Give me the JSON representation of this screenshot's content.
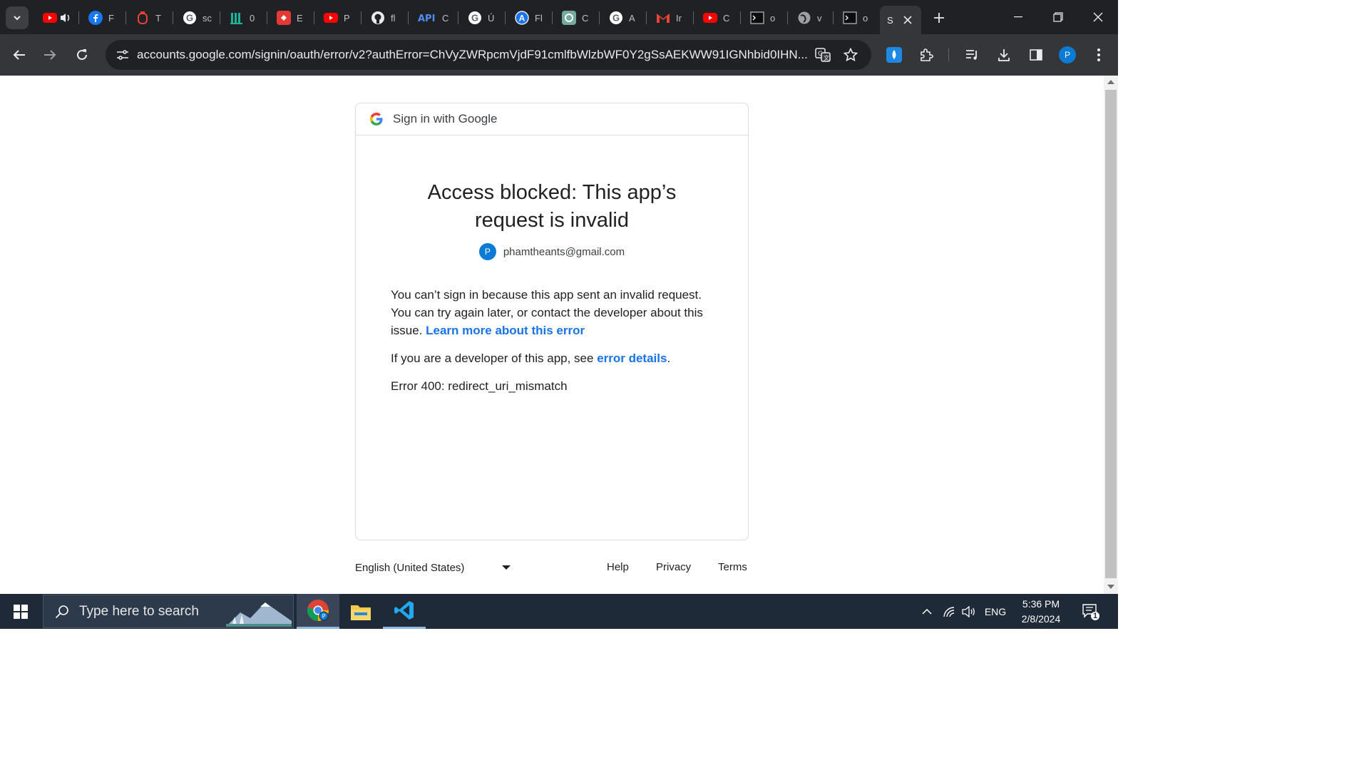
{
  "browser": {
    "tabs": [
      {
        "title": "F",
        "icon": "facebook-icon"
      },
      {
        "title": "T",
        "icon": "timer-icon"
      },
      {
        "title": "sc",
        "icon": "google-icon"
      },
      {
        "title": "0",
        "icon": "library-icon"
      },
      {
        "title": "E",
        "icon": "app-icon"
      },
      {
        "title": "P",
        "icon": "youtube-icon"
      },
      {
        "title": "fl",
        "icon": "github-icon"
      },
      {
        "title": "C",
        "icon": "api-icon"
      },
      {
        "title": "Ú",
        "icon": "google-icon"
      },
      {
        "title": "Fl",
        "icon": "a-icon"
      },
      {
        "title": "C",
        "icon": "chatgpt-icon"
      },
      {
        "title": "A",
        "icon": "google-icon"
      },
      {
        "title": "Ir",
        "icon": "gmail-icon"
      },
      {
        "title": "C",
        "icon": "youtube-icon"
      },
      {
        "title": "o",
        "icon": "terminal-icon"
      },
      {
        "title": "v",
        "icon": "globe-icon"
      },
      {
        "title": "o",
        "icon": "terminal-icon"
      }
    ],
    "active_tab": {
      "title": "S"
    },
    "url": "accounts.google.com/signin/oauth/error/v2?authError=ChVyZWRpcmVjdF91cmlfbWlzbWF0Y2gSsAEKWW91IGNhbid0IHN...",
    "profile_initial": "P"
  },
  "page": {
    "header_text": "Sign in with Google",
    "title": "Access blocked: This app’s request is invalid",
    "account": {
      "initial": "P",
      "email": "phamtheants@gmail.com"
    },
    "paragraph1": "You can’t sign in because this app sent an invalid request. You can try again later, or contact the developer about this issue. ",
    "learn_more_link": "Learn more about this error",
    "paragraph2_prefix": "If you are a developer of this app, see ",
    "error_details_link": "error details",
    "paragraph2_suffix": ".",
    "error_code": "Error 400: redirect_uri_mismatch"
  },
  "footer": {
    "language": "English (United States)",
    "help": "Help",
    "privacy": "Privacy",
    "terms": "Terms"
  },
  "taskbar": {
    "search_placeholder": "Type here to search",
    "language": "ENG",
    "time": "5:36 PM",
    "date": "2/8/2024",
    "notification_count": "1"
  },
  "colors": {
    "link": "#1a73e8",
    "avatar": "#0b7bd6",
    "chrome_dark": "#202124",
    "toolbar": "#35363a"
  }
}
